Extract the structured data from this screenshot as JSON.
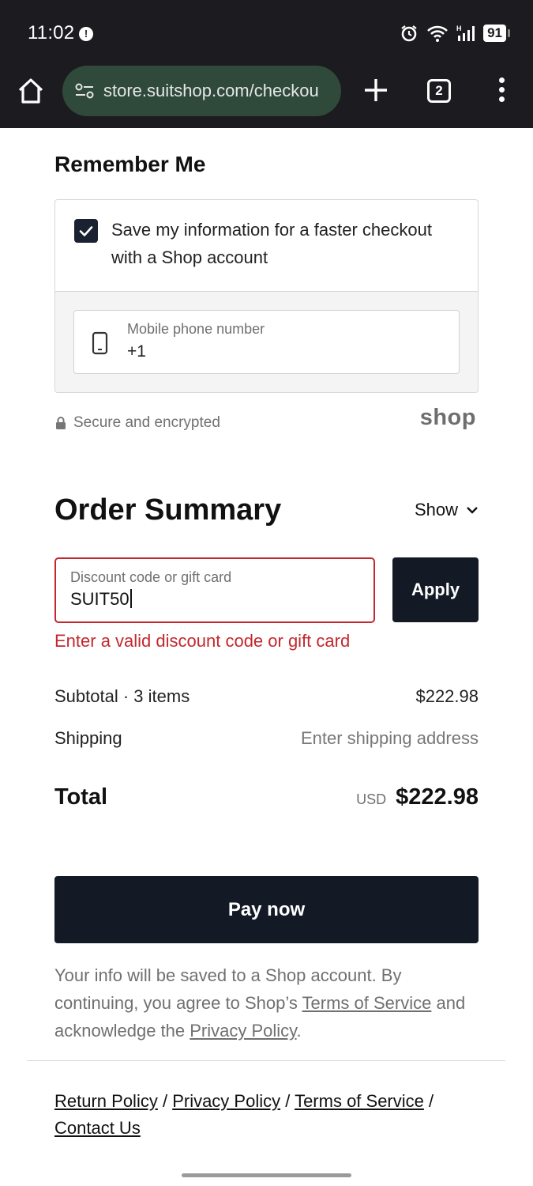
{
  "status_bar": {
    "time": "11:02",
    "notification_badge": "!",
    "battery": "91",
    "icons": [
      "alarm-icon",
      "wifi-icon",
      "signal-icon",
      "battery-icon"
    ]
  },
  "browser": {
    "url": "store.suitshop.com/checkou",
    "tab_count": "2",
    "icons": [
      "home-icon",
      "site-settings-icon",
      "plus-icon",
      "tabs-icon",
      "more-vert-icon"
    ]
  },
  "remember_me": {
    "title": "Remember Me",
    "save_checkbox_checked": true,
    "save_text": "Save my information for a faster checkout with a Shop account",
    "phone_label": "Mobile phone number",
    "phone_value": "+1",
    "secure_text": "Secure and encrypted",
    "shop_logo": "shop"
  },
  "order_summary": {
    "title": "Order Summary",
    "show_label": "Show",
    "discount_label": "Discount code or gift card",
    "discount_value": "SUIT50",
    "apply_label": "Apply",
    "error_text": "Enter a valid discount code or gift card",
    "subtotal_label": "Subtotal · 3 items",
    "subtotal_value": "$222.98",
    "shipping_label": "Shipping",
    "shipping_value": "Enter shipping address",
    "total_label": "Total",
    "currency": "USD",
    "total_value": "$222.98"
  },
  "pay_button": "Pay now",
  "legal": {
    "text_1": "Your info will be saved to a Shop account. By continuing, you agree to Shop’s ",
    "terms_link": "Terms of Service",
    "text_2": " and acknowledge the ",
    "privacy_link": "Privacy Policy",
    "text_3": "."
  },
  "footer": {
    "return_policy": "Return Policy",
    "privacy_policy": "Privacy Policy",
    "terms_of_service": "Terms of Service",
    "contact_us": "Contact Us",
    "separator": " / "
  },
  "colors": {
    "chrome_bg": "#1c1b1f",
    "url_bar_bg": "#2f4a3a",
    "button_dark": "#131a26",
    "error_red": "#c3282e"
  }
}
